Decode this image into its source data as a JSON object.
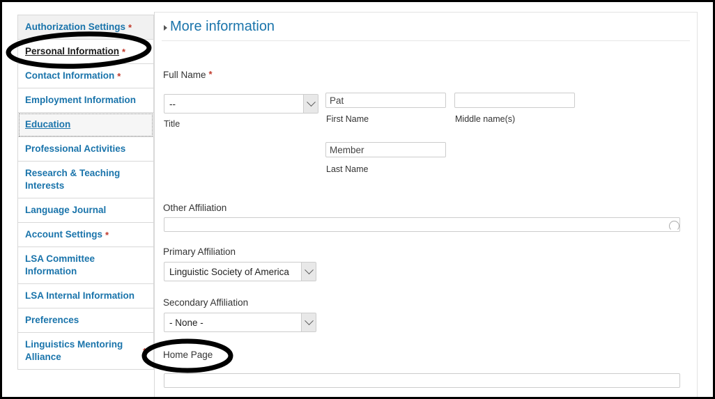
{
  "sidebar": {
    "items": [
      {
        "label": "Authorization Settings",
        "required": true,
        "state": "shaded"
      },
      {
        "label": "Personal Information",
        "required": true,
        "state": "current"
      },
      {
        "label": "Contact Information",
        "required": true,
        "state": "normal"
      },
      {
        "label": "Employment Information",
        "required": false,
        "state": "normal"
      },
      {
        "label": "Education",
        "required": false,
        "state": "focused"
      },
      {
        "label": "Professional Activities",
        "required": false,
        "state": "normal"
      },
      {
        "label": "Research & Teaching Interests",
        "required": false,
        "state": "normal"
      },
      {
        "label": "Language Journal",
        "required": false,
        "state": "normal"
      },
      {
        "label": "Account Settings",
        "required": true,
        "state": "normal"
      },
      {
        "label": "LSA Committee Information",
        "required": false,
        "state": "normal"
      },
      {
        "label": "LSA Internal Information",
        "required": false,
        "state": "normal"
      },
      {
        "label": "Preferences",
        "required": false,
        "state": "normal"
      },
      {
        "label": "Linguistics Mentoring Alliance",
        "required": true,
        "state": "normal"
      }
    ],
    "required_marker": "*"
  },
  "content": {
    "more_information": {
      "label": "More information",
      "expanded": false,
      "triangle_glyph": "disclosure-triangle-collapsed"
    },
    "full_name": {
      "group_label": "Full Name",
      "required_marker": "*",
      "title": {
        "sub_label": "Title",
        "selected": "--",
        "options": [
          "--"
        ]
      },
      "first_name": {
        "sub_label": "First Name",
        "value": "Pat",
        "placeholder": ""
      },
      "middle_name": {
        "sub_label": "Middle name(s)",
        "value": "",
        "placeholder": ""
      },
      "last_name": {
        "sub_label": "Last Name",
        "value": "Member",
        "placeholder": ""
      }
    },
    "other_affiliation": {
      "label": "Other Affiliation",
      "value": "",
      "placeholder": "",
      "icon": "autocomplete-throbber-icon"
    },
    "primary_affiliation": {
      "label": "Primary Affiliation",
      "selected": "Linguistic Society of America",
      "options": [
        "Linguistic Society of America"
      ]
    },
    "secondary_affiliation": {
      "label": "Secondary Affiliation",
      "selected": "- None -",
      "options": [
        "- None -"
      ]
    },
    "home_page": {
      "label": "Home Page",
      "value": "",
      "placeholder": ""
    }
  },
  "annotations": {
    "color": "#000000",
    "ellipses": [
      {
        "name": "personal-information-highlight",
        "target": "Personal Information"
      },
      {
        "name": "home-page-highlight",
        "target": "Home Page"
      }
    ]
  },
  "colors": {
    "link_blue": "#1a74ab",
    "required_red": "#c0392b",
    "annotation_black": "#000000",
    "border_gray": "#cccccc",
    "shaded_row": "#f1f1f1"
  }
}
